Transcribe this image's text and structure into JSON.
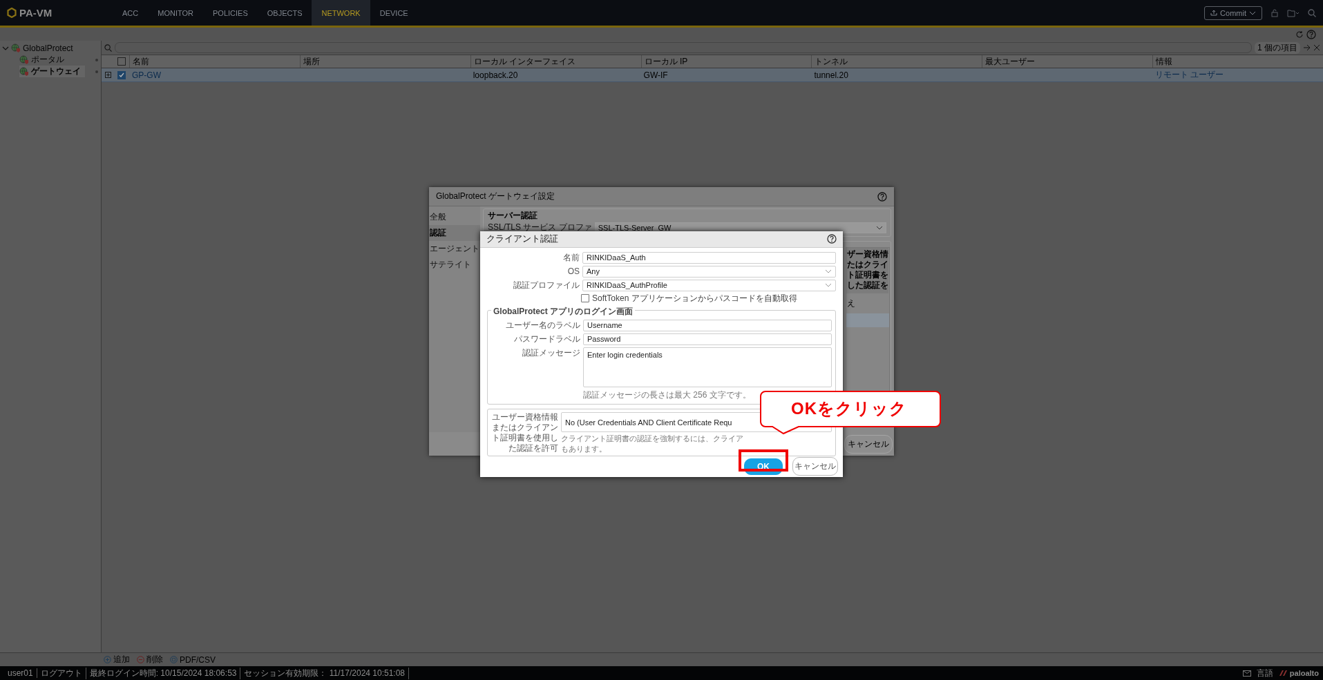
{
  "app": {
    "logo": "PA-VM",
    "commit": "Commit",
    "nav": [
      {
        "label": "ACC",
        "selected": false
      },
      {
        "label": "MONITOR",
        "selected": false
      },
      {
        "label": "POLICIES",
        "selected": false
      },
      {
        "label": "OBJECTS",
        "selected": false
      },
      {
        "label": "NETWORK",
        "selected": true
      },
      {
        "label": "DEVICE",
        "selected": false
      }
    ]
  },
  "sidebar": {
    "items": [
      {
        "label": "GlobalProtect",
        "expanded": true,
        "selected": false,
        "children": [
          {
            "label": "ポータル",
            "selected": false
          },
          {
            "label": "ゲートウェイ",
            "selected": true
          }
        ]
      }
    ]
  },
  "table": {
    "item_count": "1 個の項目",
    "select_all_checked": false,
    "columns": [
      "名前",
      "場所",
      "ローカル インターフェイス",
      "ローカル IP",
      "トンネル",
      "最大ユーザー",
      "情報"
    ],
    "rows": [
      {
        "checked": true,
        "cells": {
          "name": "GP-GW",
          "local_interface": "loopback.20",
          "local_ip": "GW-IF",
          "tunnel": "tunnel.20",
          "info": "リモート ユーザー"
        }
      }
    ]
  },
  "actions": [
    {
      "kind": "add",
      "label": "追加"
    },
    {
      "kind": "delete",
      "label": "削除"
    },
    {
      "kind": "export",
      "label": "PDF/CSV"
    }
  ],
  "status_bar": {
    "user": "user01",
    "logout": "ログアウト",
    "last_login": "最終ログイン時間: 10/15/2024 18:06:53",
    "session": "セッション有効期限： 11/17/2024 10:51:08",
    "language": "言語",
    "logo": "paloalto"
  },
  "back_dialog": {
    "title": "GlobalProtect ゲートウェイ設定",
    "tabs": [
      {
        "label": "全般",
        "selected": false
      },
      {
        "label": "認証",
        "selected": true
      },
      {
        "label": "エージェント",
        "selected": false
      },
      {
        "label": "サテライト",
        "selected": false
      }
    ],
    "server_auth": {
      "legend": "サーバー認証",
      "label": "SSL/TLS サービス プロファ",
      "value": "SSL-TLS-Server_GW"
    },
    "header_fragment": "ザー資格情たはクライト証明書をした認証を",
    "cell_fragment": "え",
    "cancel": "キャンセル"
  },
  "front_dialog": {
    "title": "クライアント認証",
    "fields": [
      {
        "kind": "text",
        "label": "名前",
        "value": "RINKIDaaS_Auth"
      },
      {
        "kind": "select",
        "label": "OS",
        "value": "Any"
      },
      {
        "kind": "select",
        "label": "認証プロファイル",
        "value": "RINKIDaaS_AuthProfile"
      }
    ],
    "softtoken": {
      "label": "SoftToken アプリケーションからパスコードを自動取得",
      "checked": false
    },
    "login_screen": {
      "legend": "GlobalProtect アプリのログイン画面",
      "fields": [
        {
          "kind": "text",
          "label": "ユーザー名のラベル",
          "value": "Username"
        },
        {
          "kind": "text",
          "label": "パスワードラベル",
          "value": "Password"
        },
        {
          "kind": "textarea",
          "label": "認証メッセージ",
          "value": "Enter login credentials",
          "hint": "認証メッセージの長さは最大 256 文字です。"
        }
      ]
    },
    "allow_auth": {
      "label": "ユーザー資格情報またはクライアント証明書を使用した認証を許可",
      "value": "No (User Credentials AND Client Certificate Requ",
      "hint_lines": [
        "クライアント証明書の認証を強制するには、クライア",
        "もあります。"
      ]
    },
    "buttons": [
      {
        "kind": "primary",
        "label": "OK"
      },
      {
        "kind": "secondary",
        "label": "キャンセル"
      }
    ]
  },
  "callout": {
    "text": "OKをクリック"
  }
}
